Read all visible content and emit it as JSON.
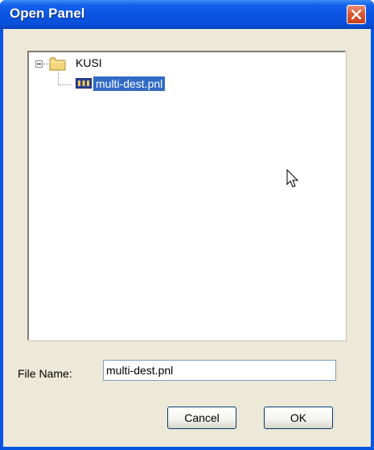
{
  "window": {
    "title": "Open Panel",
    "close_icon": "close-icon",
    "accent_color": "#0854e3"
  },
  "tree": {
    "root": {
      "label": "KUSI",
      "icon": "folder-icon",
      "expanded": true
    },
    "children": [
      {
        "label": "multi-dest.pnl",
        "icon": "panel-file-icon",
        "selected": true
      }
    ]
  },
  "file_name": {
    "label": "File Name:",
    "value": "multi-dest.pnl"
  },
  "buttons": {
    "cancel": "Cancel",
    "ok": "OK"
  }
}
